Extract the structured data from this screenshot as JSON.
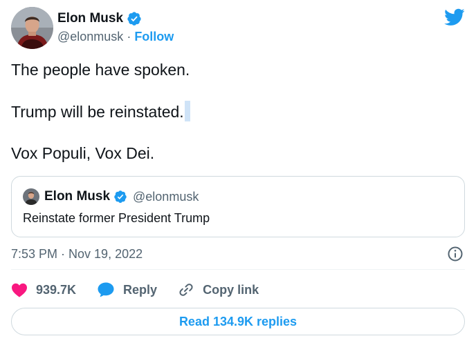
{
  "author": {
    "name": "Elon Musk",
    "handle": "@elonmusk",
    "separator": "·",
    "follow_label": "Follow"
  },
  "tweet": {
    "lines": [
      "The people have spoken.",
      "Trump will be reinstated.",
      "Vox Populi, Vox Dei."
    ]
  },
  "quoted_tweet": {
    "name": "Elon Musk",
    "handle": "@elonmusk",
    "text": "Reinstate former President Trump"
  },
  "timestamp": "7:53 PM · Nov 19, 2022",
  "actions": {
    "likes": "939.7K",
    "reply_label": "Reply",
    "copy_link_label": "Copy link"
  },
  "replies_button_label": "Read 134.9K replies",
  "colors": {
    "accent": "#1d9bf0",
    "heart": "#f91880",
    "text_primary": "#0f1419",
    "text_secondary": "#536471",
    "border": "#cfd9de"
  },
  "icons": {
    "verified": "verified-badge-icon",
    "twitter": "twitter-bird-icon",
    "info": "info-icon",
    "like": "heart-icon",
    "reply": "reply-bubble-icon",
    "link": "link-icon"
  }
}
